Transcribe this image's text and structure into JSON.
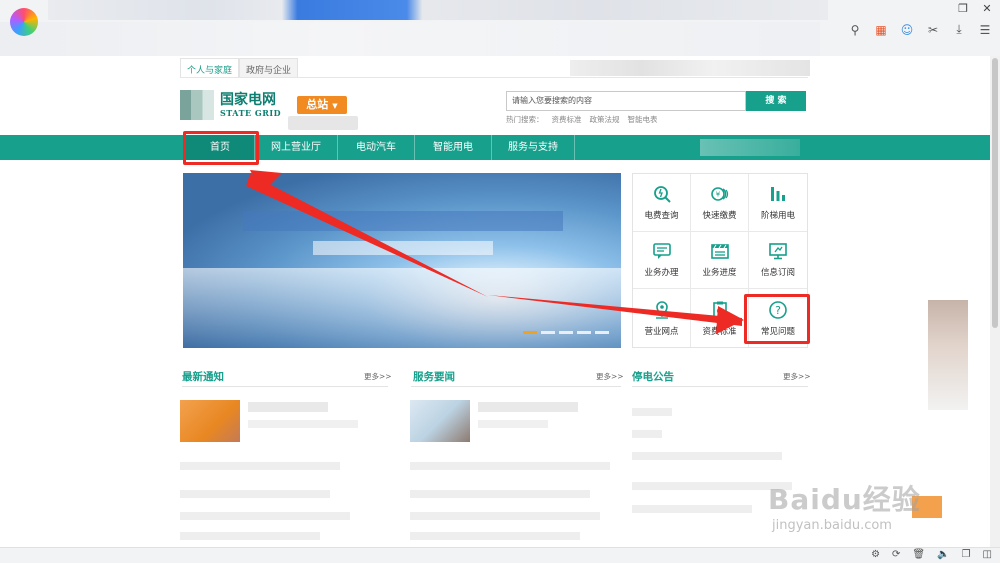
{
  "site": {
    "tabs": [
      "个人与家庭",
      "政府与企业"
    ],
    "brand_cn": "国家电网",
    "brand_en": "STATE GRID",
    "region": "总站",
    "search_placeholder": "请输入您要搜索的内容",
    "search_button": "搜 索",
    "hot_label": "热门搜索：",
    "hot_items": [
      "资费标准",
      "政策法规",
      "智能电表"
    ]
  },
  "nav": [
    "首页",
    "网上营业厅",
    "电动汽车",
    "智能用电",
    "服务与支持"
  ],
  "services": [
    {
      "label": "电费查询",
      "icon": "search-bill-icon"
    },
    {
      "label": "快速缴费",
      "icon": "coin-icon"
    },
    {
      "label": "阶梯用电",
      "icon": "bar-chart-icon"
    },
    {
      "label": "业务办理",
      "icon": "chat-icon"
    },
    {
      "label": "业务进度",
      "icon": "film-icon"
    },
    {
      "label": "信息订阅",
      "icon": "monitor-icon"
    },
    {
      "label": "营业网点",
      "icon": "location-icon"
    },
    {
      "label": "资费标准",
      "icon": "clipboard-icon"
    },
    {
      "label": "常见问题",
      "icon": "question-icon"
    }
  ],
  "sections": [
    {
      "title": "最新通知",
      "more": "更多>>"
    },
    {
      "title": "服务要闻",
      "more": "更多>>"
    },
    {
      "title": "停电公告",
      "more": "更多>>"
    }
  ],
  "watermark": {
    "main": "Baidu经验",
    "sub": "jingyan.baidu.com"
  },
  "colors": {
    "primary": "#17a08c",
    "accent": "#f08a21",
    "annotation": "#ee2a24"
  }
}
